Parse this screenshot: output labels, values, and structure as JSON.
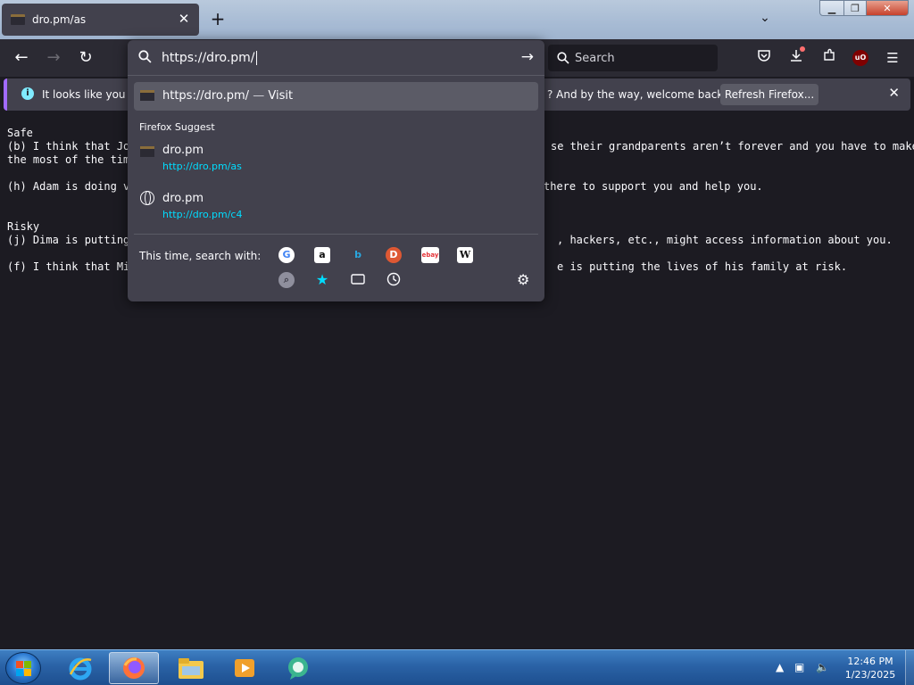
{
  "browser": {
    "tab": {
      "title": "dro.pm/as"
    },
    "new_tab_icon": "plus-icon",
    "address": {
      "value": "https://dro.pm/"
    },
    "search": {
      "placeholder": "Search"
    },
    "accent_color": "#a26bff",
    "link_color": "#00ddff"
  },
  "notification": {
    "message_start": "It looks like you ha",
    "message_end": "? And by the way, welcome back!",
    "button_label": "Refresh Firefox..."
  },
  "urlbar": {
    "heuristic": {
      "url": "https://dro.pm/",
      "separator": "—",
      "action": "Visit"
    },
    "suggest_header": "Firefox Suggest",
    "suggestions": [
      {
        "title": "dro.pm",
        "url": "http://dro.pm/as",
        "icon": "site-favicon"
      },
      {
        "title": "dro.pm",
        "url": "http://dro.pm/c4",
        "icon": "globe-icon"
      }
    ],
    "oneoff_label": "This time, search with:",
    "engines": [
      {
        "name": "Google",
        "glyph": "G"
      },
      {
        "name": "Amazon",
        "glyph": "a"
      },
      {
        "name": "Bing",
        "glyph": "b"
      },
      {
        "name": "DuckDuckGo",
        "glyph": "D"
      },
      {
        "name": "eBay",
        "glyph": "ebay"
      },
      {
        "name": "Wikipedia",
        "glyph": "W"
      }
    ]
  },
  "page": {
    "lines": [
      "Safe",
      "(b) I think that Jor",
      "the most of the tim",
      "(h) Adam is doing v",
      "Risky",
      "(j) Dima is putting",
      "(f) I think that Mi"
    ],
    "lines_right": [
      "se their grandparents aren’t forever and you have to make",
      "there to support you and help you.",
      ", hackers, etc., might access information about you.",
      "e is putting the lives of his family at risk."
    ]
  },
  "taskbar": {
    "time": "12:46 PM",
    "date": "1/23/2025"
  }
}
